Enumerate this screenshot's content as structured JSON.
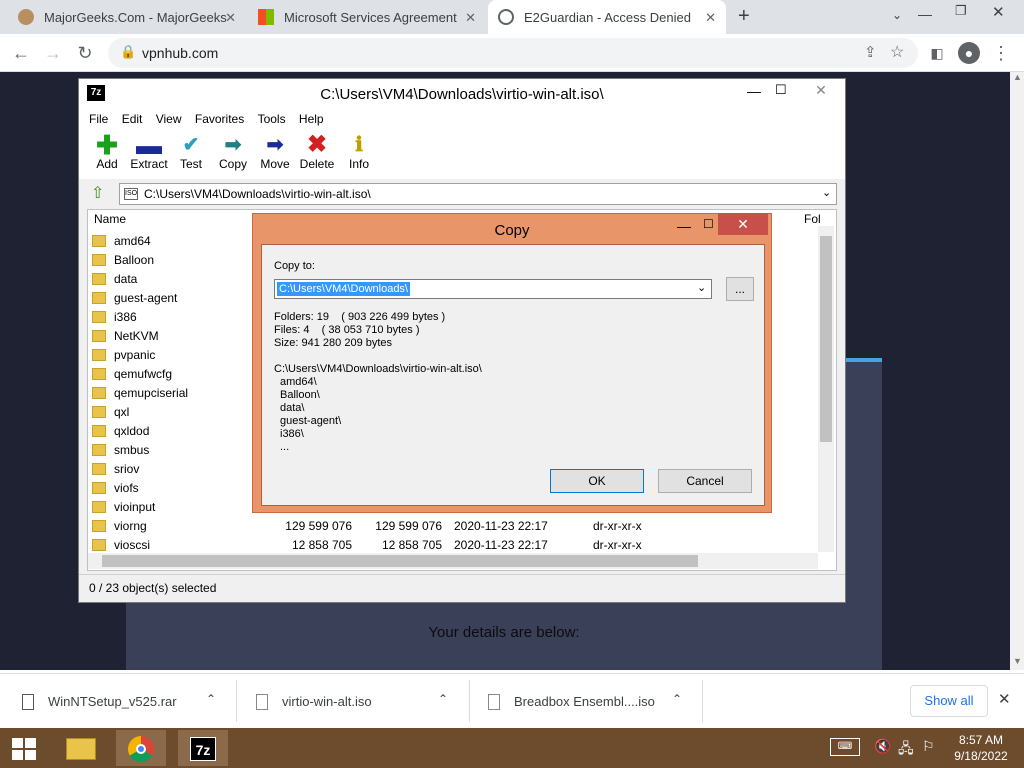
{
  "browser": {
    "tabs": [
      {
        "title": "MajorGeeks.Com - MajorGeeks",
        "active": false
      },
      {
        "title": "Microsoft Services Agreement",
        "active": false
      },
      {
        "title": "E2Guardian - Access Denied",
        "active": true
      }
    ],
    "url": "vpnhub.com"
  },
  "page": {
    "details_text": "Your details are below:"
  },
  "sevenzip": {
    "title": "C:\\Users\\VM4\\Downloads\\virtio-win-alt.iso\\",
    "menu": [
      "File",
      "Edit",
      "View",
      "Favorites",
      "Tools",
      "Help"
    ],
    "toolbar": [
      {
        "label": "Add",
        "icon": "plus-icon",
        "color": "#1aa01a"
      },
      {
        "label": "Extract",
        "icon": "minus-icon",
        "color": "#1a2a9a"
      },
      {
        "label": "Test",
        "icon": "check-icon",
        "color": "#2aa0c0"
      },
      {
        "label": "Copy",
        "icon": "copy-arrow-icon",
        "color": "#208080"
      },
      {
        "label": "Move",
        "icon": "move-arrow-icon",
        "color": "#1a2a9a"
      },
      {
        "label": "Delete",
        "icon": "x-icon",
        "color": "#d02020"
      },
      {
        "label": "Info",
        "icon": "info-icon",
        "color": "#c0a000"
      }
    ],
    "address": "C:\\Users\\VM4\\Downloads\\virtio-win-alt.iso\\",
    "columns": {
      "name": "Name",
      "folders": "Fol"
    },
    "folders": [
      "amd64",
      "Balloon",
      "data",
      "guest-agent",
      "i386",
      "NetKVM",
      "pvpanic",
      "qemufwcfg",
      "qemupciserial",
      "qxl",
      "qxldod",
      "smbus",
      "sriov",
      "viofs",
      "vioinput",
      "viorng",
      "vioscsi"
    ],
    "detail_rows": [
      {
        "name": "viorng",
        "size": "129 599 076",
        "packed": "129 599 076",
        "modified": "2020-11-23 22:17",
        "attr": "dr-xr-xr-x"
      },
      {
        "name": "vioscsi",
        "size": "12 858 705",
        "packed": "12 858 705",
        "modified": "2020-11-23 22:17",
        "attr": "dr-xr-xr-x"
      }
    ],
    "status": "0 / 23 object(s) selected"
  },
  "copy_dialog": {
    "title": "Copy",
    "copy_to_label": "Copy to:",
    "destination": "C:\\Users\\VM4\\Downloads\\",
    "browse_label": "...",
    "folders_line": "Folders: 19    ( 903 226 499 bytes )",
    "files_line": "Files: 4    ( 38 053 710 bytes )",
    "size_line": "Size: 941 280 209 bytes",
    "source_path": "C:\\Users\\VM4\\Downloads\\virtio-win-alt.iso\\",
    "source_items": [
      "amd64\\",
      "Balloon\\",
      "data\\",
      "guest-agent\\",
      "i386\\",
      "..."
    ],
    "ok_label": "OK",
    "cancel_label": "Cancel"
  },
  "downloads": {
    "items": [
      "WinNTSetup_v525.rar",
      "virtio-win-alt.iso",
      "Breadbox Ensembl....iso"
    ],
    "show_all": "Show all"
  },
  "taskbar": {
    "time": "8:57 AM",
    "date": "9/18/2022"
  }
}
